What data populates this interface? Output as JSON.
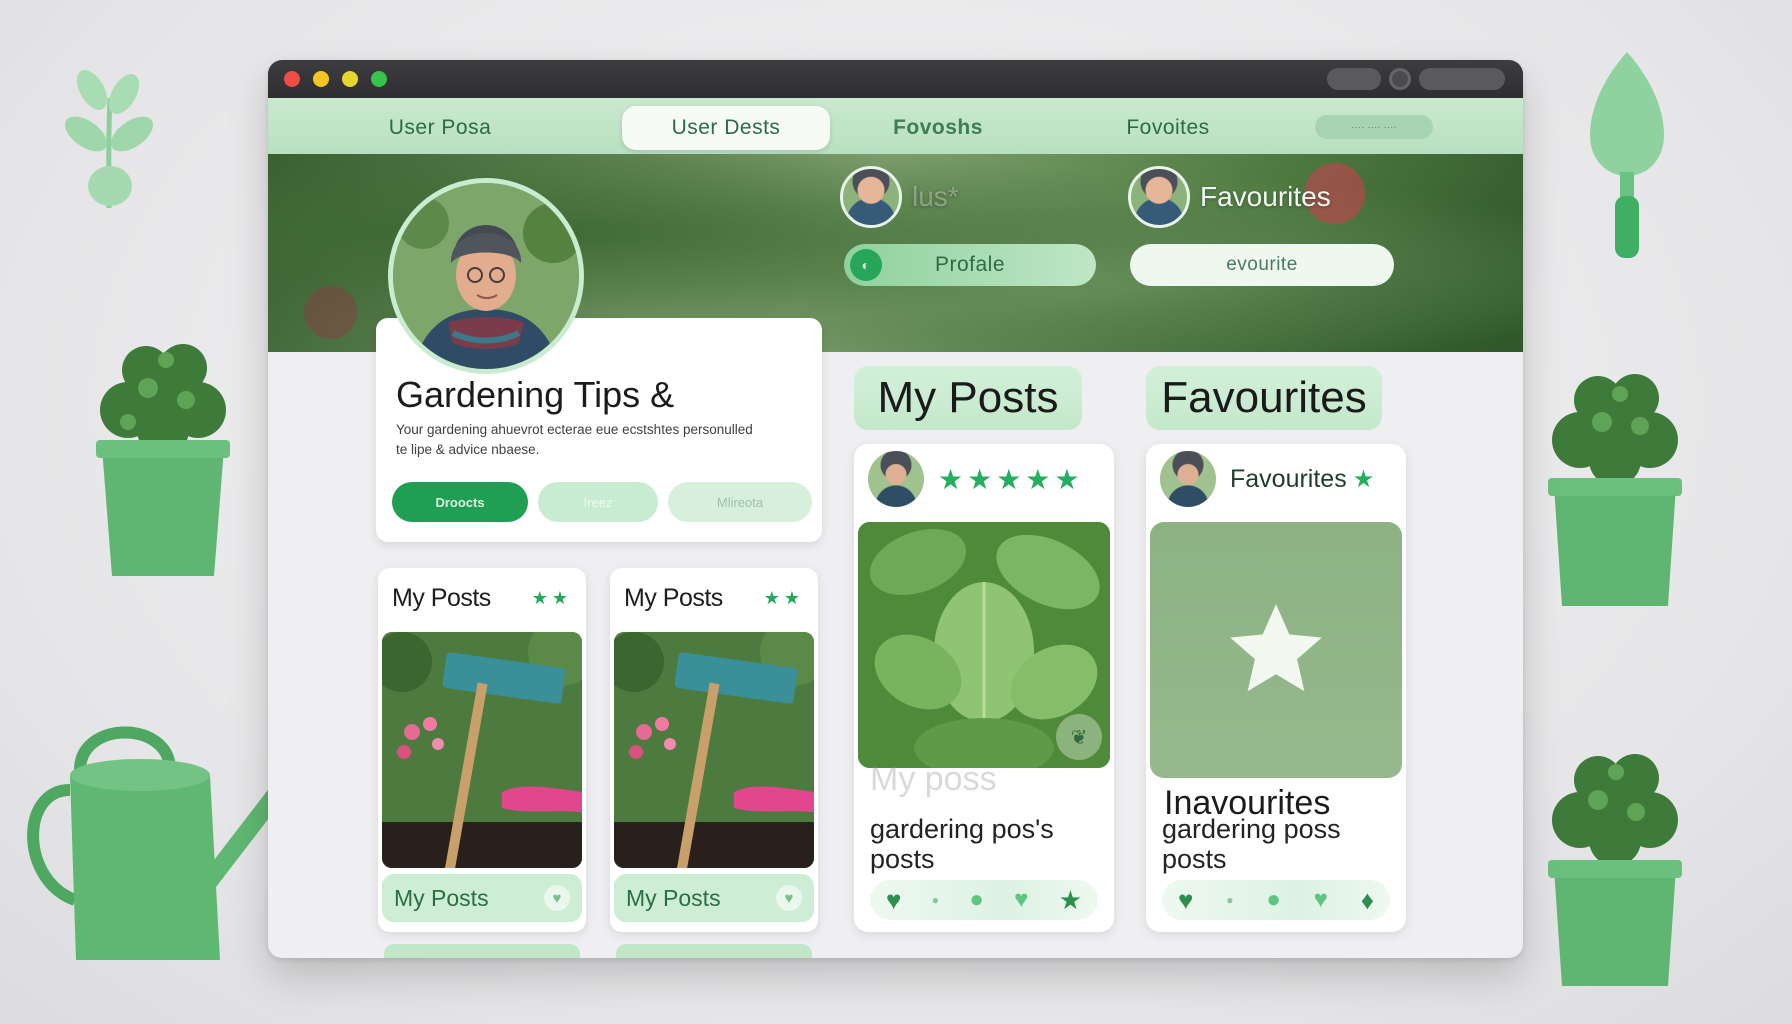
{
  "window": {
    "tabs": [
      {
        "label": "User Posa"
      },
      {
        "label": "User Dests"
      },
      {
        "label": "Fovoshs"
      },
      {
        "label": "Fovoites"
      }
    ],
    "search_placeholder": "···· ···· ····"
  },
  "hero": {
    "user_one": {
      "label": "lus*"
    },
    "user_two": {
      "label": "Favourites"
    },
    "profile_button": "Profale",
    "favourite_button": "evourite"
  },
  "profile": {
    "title": "Gardening Tips &",
    "description": "Your gardening ahuevrot ecterae eue ecstshtes personulled te lipe & advice nbaese.",
    "buttons": [
      "Droocts",
      "Ireez",
      "Mlireota"
    ]
  },
  "small_cards": [
    {
      "title": "My Posts",
      "footer": "My Posts"
    },
    {
      "title": "My Posts",
      "footer": "My Posts"
    }
  ],
  "sections": {
    "my_posts": {
      "title": "My Posts",
      "card": {
        "faint_caption": "My poss",
        "body": "gardering pos's posts"
      }
    },
    "favourites": {
      "title": "Favourites",
      "card": {
        "head_label": "Favourites",
        "headline": "Inavourites",
        "body": "gardering poss posts"
      }
    }
  },
  "colors": {
    "accent": "#1f9e54",
    "tab_bar": "#c9e9cf",
    "title_bar": "#2e2e31"
  }
}
